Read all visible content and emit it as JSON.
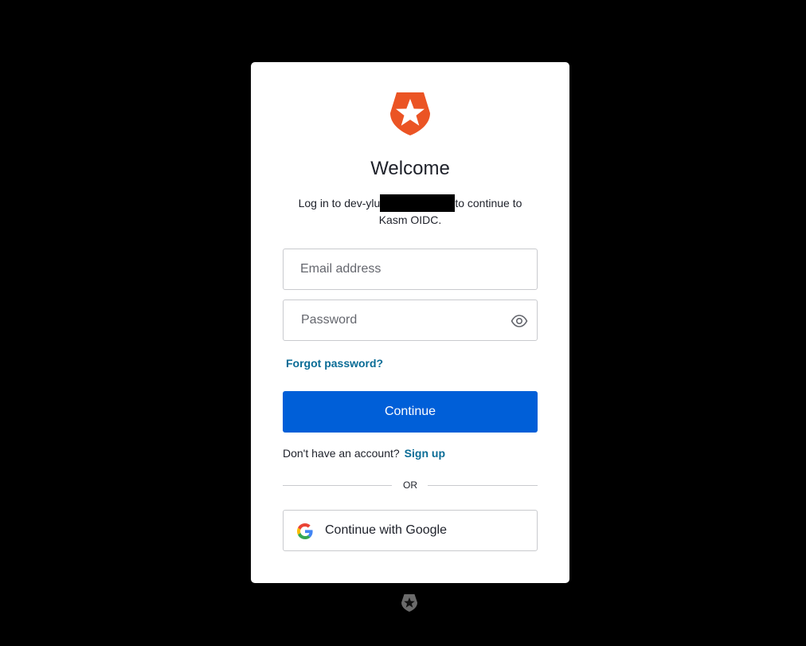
{
  "brand": {
    "logo_icon": "auth0-shield-icon",
    "accent_color": "#eb5424"
  },
  "header": {
    "title": "Welcome",
    "subtitle_prefix": "Log in to dev-ylu",
    "subtitle_suffix": "to continue to Kasm OIDC."
  },
  "form": {
    "email_placeholder": "Email address",
    "password_placeholder": "Password",
    "password_toggle_icon": "eye-icon",
    "forgot_password": "Forgot password?",
    "continue_label": "Continue",
    "continue_color": "#005fd8"
  },
  "signup": {
    "prompt": "Don't have an account?",
    "link": "Sign up"
  },
  "divider": {
    "label": "OR"
  },
  "social": {
    "google_label": "Continue with Google",
    "google_icon": "google-icon"
  },
  "footer": {
    "badge_icon": "auth0-badge-icon"
  }
}
